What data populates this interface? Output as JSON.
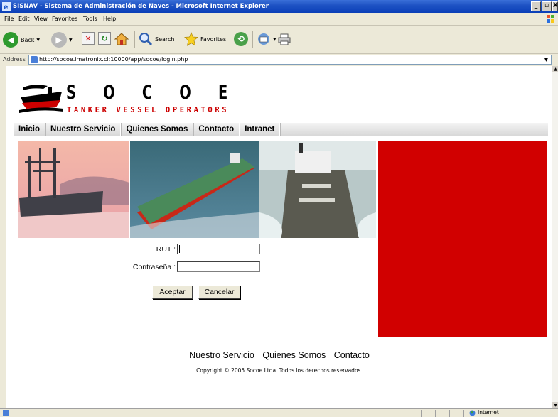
{
  "window": {
    "title": "SISNAV - Sistema de Administración de Naves - Microsoft Internet Explorer",
    "controls": [
      "_",
      "̱□",
      "X"
    ]
  },
  "menu": [
    "File",
    "Edit",
    "View",
    "Favorites",
    "Tools",
    "Help"
  ],
  "toolbar": {
    "back_label": "Back",
    "search_label": "Search",
    "favorites_label": "Favorites"
  },
  "address": {
    "label": "Address",
    "url": "http://socoe.imatronix.cl:10000/app/socoe/login.php"
  },
  "site": {
    "logo_letters": [
      "S",
      "O",
      "C",
      "O",
      "E"
    ],
    "logo_tagline": "TANKER VESSEL OPERATORS",
    "nav": [
      "Inicio",
      "Nuestro Servicio",
      "Quienes Somos",
      "Contacto",
      "Intranet"
    ],
    "accent_color": "#d10000"
  },
  "login": {
    "rut_label": "RUT :",
    "rut_value": "",
    "password_label": "Contraseña :",
    "password_value": "",
    "submit_label": "Aceptar",
    "cancel_label": "Cancelar"
  },
  "footer": {
    "links": [
      "Nuestro Servicio",
      "Quienes Somos",
      "Contacto"
    ],
    "copyright": "Copyright © 2005 Socoe Ltda. Todos los derechos reservados."
  },
  "status": {
    "zone": "Internet"
  }
}
